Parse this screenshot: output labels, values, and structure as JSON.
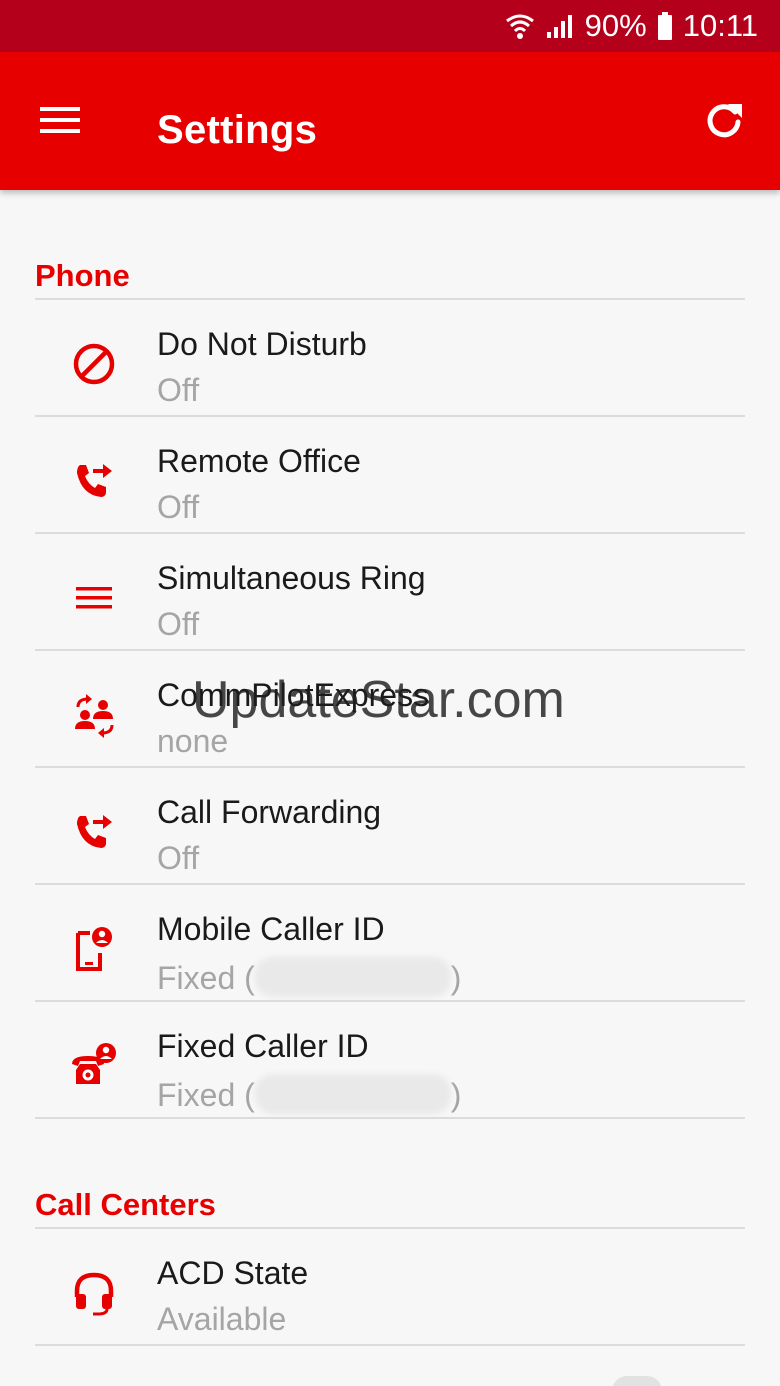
{
  "status_bar": {
    "battery": "90%",
    "time": "10:11"
  },
  "app_bar": {
    "title": "Settings"
  },
  "sections": {
    "phone": {
      "title": "Phone"
    },
    "call_centers": {
      "title": "Call Centers"
    }
  },
  "phone_items": [
    {
      "label": "Do Not Disturb",
      "value": "Off",
      "icon": "block-icon"
    },
    {
      "label": "Remote Office",
      "value": "Off",
      "icon": "call-forward-icon"
    },
    {
      "label": "Simultaneous Ring",
      "value": "Off",
      "icon": "lines-icon"
    },
    {
      "label": "CommPilotExpress",
      "value": "none",
      "icon": "people-swap-icon"
    },
    {
      "label": "Call Forwarding",
      "value": "Off",
      "icon": "call-forward-icon"
    },
    {
      "label": "Mobile Caller ID",
      "value_prefix": "Fixed (",
      "value_suffix": ")",
      "icon": "mobile-user-icon"
    },
    {
      "label": "Fixed Caller ID",
      "value_prefix": "Fixed (",
      "value_suffix": ")",
      "icon": "desk-phone-user-icon"
    }
  ],
  "call_center_items": [
    {
      "label": "ACD State",
      "value": "Available",
      "icon": "headset-icon"
    }
  ],
  "watermark": "UpdateStar.com",
  "colors": {
    "accent": "#e60000",
    "status_bar": "#b5001b",
    "secondary_text": "#a5a5a5"
  }
}
